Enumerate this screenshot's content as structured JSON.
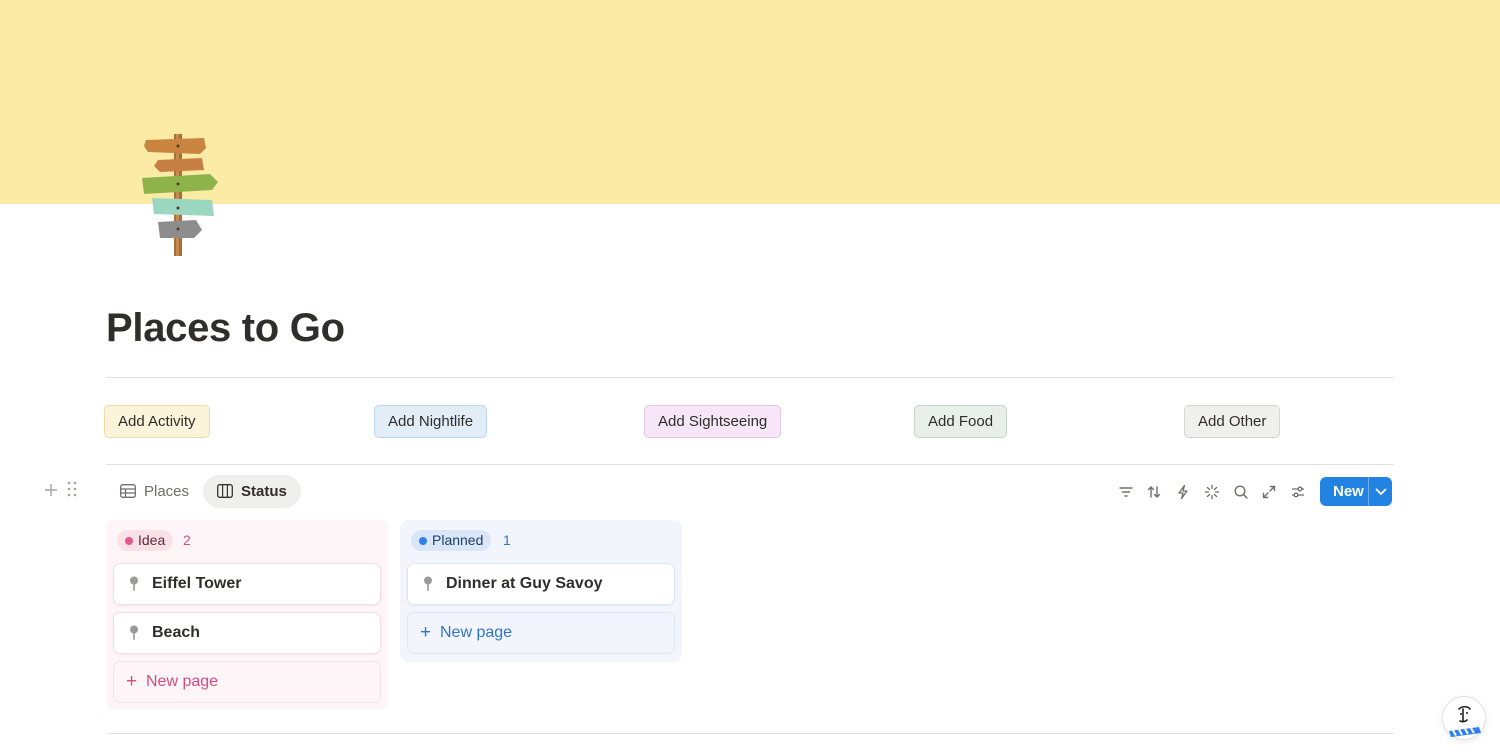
{
  "colors": {
    "cover": "#fbeba4",
    "accent": "#2383e2",
    "idea_pill_bg": "#fae1e8",
    "idea_dot": "#e3598b",
    "idea_text": "#d44c7f",
    "planned_pill_bg": "#d9e6f7",
    "planned_dot": "#2f80ed",
    "planned_text": "#2f75c9"
  },
  "page": {
    "title": "Places to Go",
    "cover_type": "solid-yellow",
    "icon": "signpost-icon"
  },
  "buttons": [
    {
      "label": "Add Activity",
      "bg": "#fbf3da",
      "border": "#ebdca8"
    },
    {
      "label": "Add Nightlife",
      "bg": "#e1eef8",
      "border": "#bcd7ee"
    },
    {
      "label": "Add Sightseeing",
      "bg": "#f6e6f7",
      "border": "#e3c6e6"
    },
    {
      "label": "Add Food",
      "bg": "#e8eee8",
      "border": "#c8d4c8"
    },
    {
      "label": "Add Other",
      "bg": "#efefee",
      "border": "#d6d5d1"
    }
  ],
  "views": {
    "tabs": [
      {
        "label": "Places",
        "icon": "table-icon",
        "active": false
      },
      {
        "label": "Status",
        "icon": "board-icon",
        "active": true
      }
    ],
    "toolbar": {
      "icons": [
        "filter-icon",
        "sort-icon",
        "automation-icon",
        "ai-sparkle-icon",
        "search-icon",
        "expand-icon",
        "settings-icon"
      ],
      "new_label": "New"
    }
  },
  "board": {
    "columns": [
      {
        "status": "Idea",
        "count": "2",
        "cards": [
          {
            "title": "Eiffel Tower",
            "icon": "pin-icon"
          },
          {
            "title": "Beach",
            "icon": "pin-icon"
          }
        ],
        "new_page_label": "New page"
      },
      {
        "status": "Planned",
        "count": "1",
        "cards": [
          {
            "title": "Dinner at Guy Savoy",
            "icon": "pin-icon"
          }
        ],
        "new_page_label": "New page"
      }
    ]
  },
  "assistant": {
    "icon": "notion-ai-face-icon"
  }
}
